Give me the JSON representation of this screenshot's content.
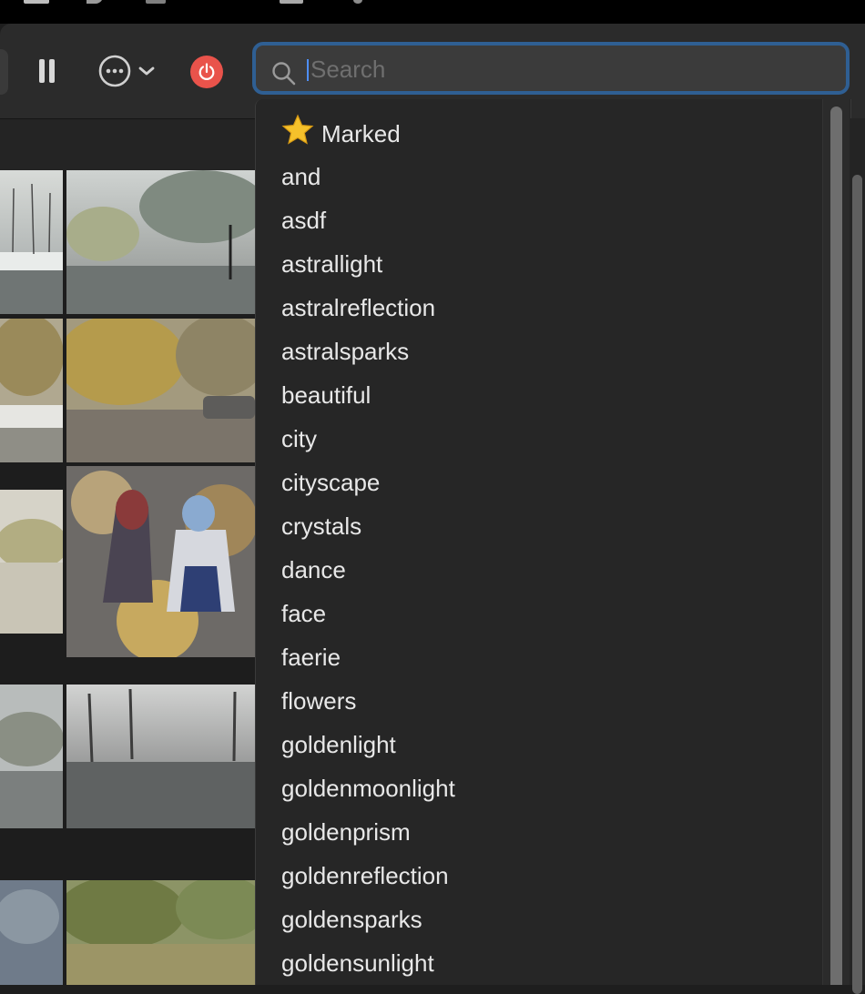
{
  "search": {
    "placeholder": "Search",
    "value": ""
  },
  "dropdown": {
    "items": [
      {
        "label": "Marked",
        "icon": "star-icon"
      },
      {
        "label": "and"
      },
      {
        "label": "asdf"
      },
      {
        "label": "astrallight"
      },
      {
        "label": "astralreflection"
      },
      {
        "label": "astralsparks"
      },
      {
        "label": "beautiful"
      },
      {
        "label": "city"
      },
      {
        "label": "cityscape"
      },
      {
        "label": "crystals"
      },
      {
        "label": "dance"
      },
      {
        "label": "face"
      },
      {
        "label": "faerie"
      },
      {
        "label": "flowers"
      },
      {
        "label": "goldenlight"
      },
      {
        "label": "goldenmoonlight"
      },
      {
        "label": "goldenprism"
      },
      {
        "label": "goldenreflection"
      },
      {
        "label": "goldensparks"
      },
      {
        "label": "goldensunlight"
      }
    ]
  },
  "toolbar": {
    "icons": [
      "pause-icon",
      "more-options-icon",
      "chevron-down-icon",
      "power-icon"
    ]
  },
  "colors": {
    "accent": "#2f5f93",
    "power": "#e9534b",
    "caret": "#4e8ef7"
  }
}
